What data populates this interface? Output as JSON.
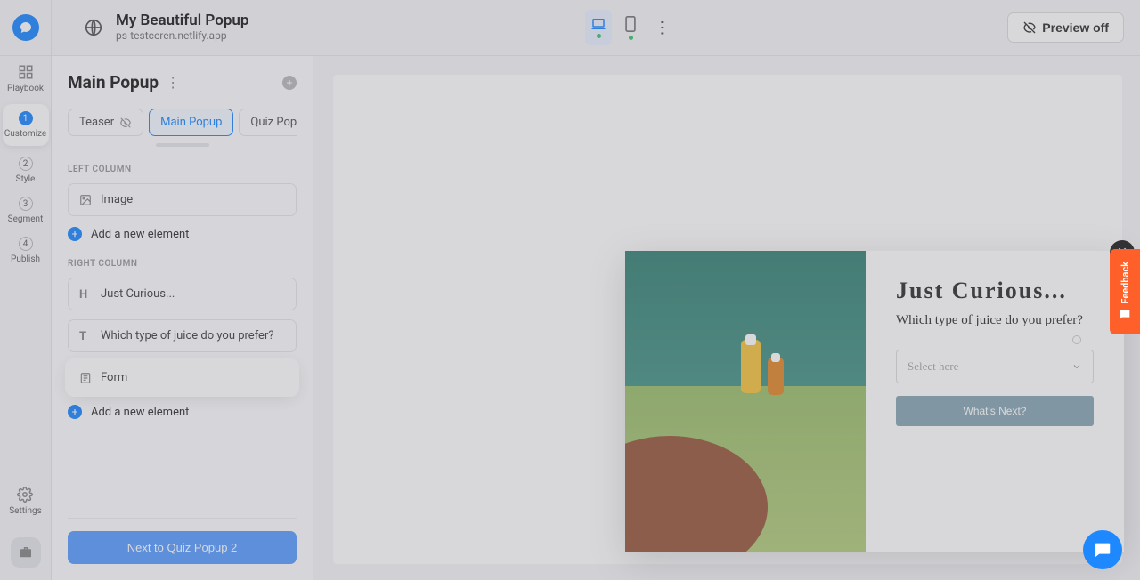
{
  "header": {
    "title": "My Beautiful Popup",
    "subtitle": "ps-testceren.netlify.app",
    "preview_label": "Preview off"
  },
  "leftrail": {
    "playbook": "Playbook",
    "step1_num": "1",
    "step1_label": "Customize",
    "step2_num": "2",
    "step2_label": "Style",
    "step3_num": "3",
    "step3_label": "Segment",
    "step4_num": "4",
    "step4_label": "Publish",
    "settings": "Settings"
  },
  "editor": {
    "title": "Main Popup",
    "tabs": {
      "teaser": "Teaser",
      "main": "Main Popup",
      "quiz": "Quiz Popu"
    },
    "left_column_label": "LEFT COLUMN",
    "right_column_label": "RIGHT COLUMN",
    "image_item": "Image",
    "heading_item": "Just Curious...",
    "text_item": "Which type of juice do you prefer?",
    "form_item": "Form",
    "add_element": "Add a new element",
    "next_btn": "Next to Quiz Popup 2"
  },
  "popup": {
    "heading": "Just Curious...",
    "question": "Which type of juice do you prefer?",
    "select_placeholder": "Select here",
    "cta": "What's Next?"
  },
  "feedback": {
    "label": "Feedback"
  }
}
